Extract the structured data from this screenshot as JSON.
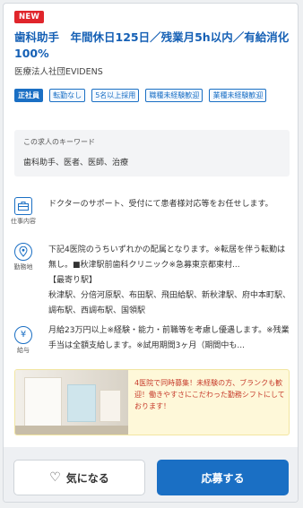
{
  "badge": {
    "new_label": "NEW"
  },
  "job": {
    "title": "歯科助手　年間休日125日／残業月5h以内／有給消化100%",
    "company": "医療法人社団EVIDENS"
  },
  "tags": [
    "正社員",
    "転勤なし",
    "5名以上採用",
    "職種未経験歓迎",
    "業種未経験歓迎"
  ],
  "keywords": {
    "label": "この求人のキーワード",
    "text": "歯科助手、医者、医師、治療"
  },
  "sections": {
    "work": {
      "icon": "briefcase-icon",
      "caption": "仕事内容",
      "text": "ドクターのサポート、受付にて患者様対応等をお任せします。"
    },
    "location": {
      "icon": "location-pin-icon",
      "caption": "勤務地",
      "text": "下記4医院のうちいずれかの配属となります。※転居を伴う転勤は無し。■秋津駅前歯科クリニック※急募東京都東村...",
      "station_label": "【最寄り駅】",
      "stations": "秋津駅、分倍河原駅、布田駅、飛田給駅、新秋津駅、府中本町駅、調布駅、西調布駅、国領駅"
    },
    "salary": {
      "icon": "yen-icon",
      "caption": "給与",
      "text": "月給23万円以上※経験・能力・前職等を考慮し優遇します。※残業手当は全額支給します。※試用期間3ヶ月（期間中も..."
    }
  },
  "banner": {
    "text": "4医院で同時募集！未経験の方、ブランクも歓迎！働きやすさにこだわった勤務シフトにしております！"
  },
  "actions": {
    "favorite_label": "気になる",
    "apply_label": "応募する"
  },
  "colors": {
    "accent": "#1a6fc4",
    "badge": "#e0252b",
    "banner_text": "#c63a2a"
  }
}
